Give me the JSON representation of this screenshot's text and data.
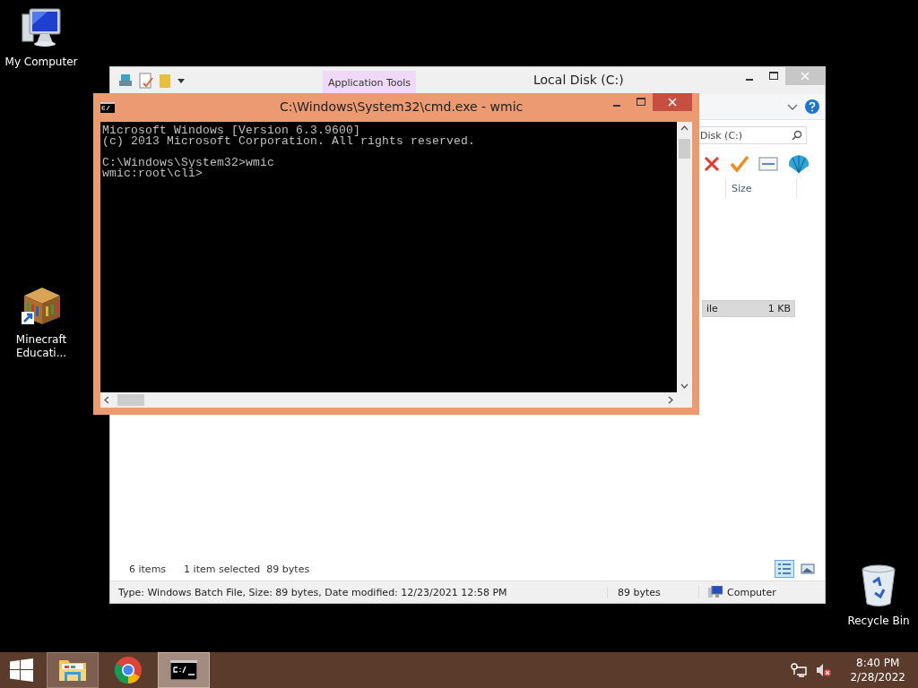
{
  "desktop_icons": [
    {
      "kind": "computer",
      "label": "My Computer"
    },
    {
      "kind": "bookshelf",
      "label": "Minecraft Educati..."
    },
    {
      "kind": "recycle",
      "label": "Recycle Bin"
    }
  ],
  "explorer": {
    "title": "Local Disk (C:)",
    "context_tab": "Application Tools",
    "search": {
      "value": "Disk (C:)"
    },
    "columns": [
      "Size"
    ],
    "rows": [
      {
        "column_1": "ile",
        "size": "1 KB",
        "selected": true
      }
    ],
    "item_count": "6 items",
    "selection_info": "1 item selected  89 bytes",
    "views": [
      {
        "kind": "details",
        "selected": true
      },
      {
        "kind": "thumbnails",
        "selected": false
      }
    ],
    "status_bar": {
      "details": "Type: Windows Batch File, Size: 89 bytes, Date modified: 12/23/2021 12:58 PM",
      "size": "89 bytes",
      "location": "Computer"
    }
  },
  "console": {
    "title": "C:\\Windows\\System32\\cmd.exe - wmic",
    "blocks": [
      [
        "Microsoft Windows [Version 6.3.9600]",
        "(c) 2013 Microsoft Corporation. All rights reserved."
      ],
      [
        "C:\\Windows\\System32>wmic",
        "wmic:root\\cli>"
      ]
    ]
  },
  "taskbar": {
    "apps": [
      {
        "kind": "explorer",
        "running": true,
        "selected": false
      },
      {
        "kind": "chrome",
        "running": false,
        "selected": false
      },
      {
        "kind": "console",
        "running": true,
        "selected": true
      }
    ],
    "time": "8:40 PM",
    "date": "2/28/2022"
  }
}
